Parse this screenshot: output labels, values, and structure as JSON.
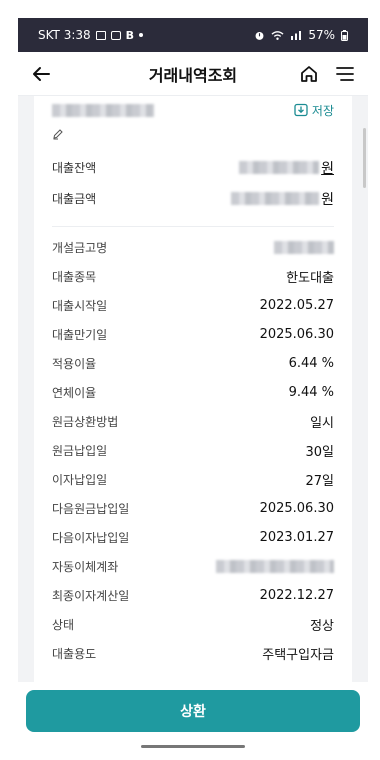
{
  "status_bar": {
    "carrier_time": "SKT 3:38",
    "battery": "57%",
    "left_icons": [
      "gallery-icon",
      "chat-icon",
      "b-app-icon",
      "dot-icon"
    ],
    "right_icons": [
      "alarm-icon",
      "wifi-icon",
      "signal-icon",
      "battery-icon"
    ]
  },
  "app_bar": {
    "title": "거래내역조회",
    "back_icon": "back-arrow-icon",
    "home_icon": "home-icon",
    "menu_icon": "menu-icon"
  },
  "card": {
    "save_label": "저장",
    "amounts": [
      {
        "label": "대출잔액",
        "unit": "원"
      },
      {
        "label": "대출금액",
        "unit": "원"
      }
    ],
    "details": [
      {
        "label": "개설금고명",
        "value": null
      },
      {
        "label": "대출종목",
        "value": "한도대출"
      },
      {
        "label": "대출시작일",
        "value": "2022.05.27"
      },
      {
        "label": "대출만기일",
        "value": "2025.06.30"
      },
      {
        "label": "적용이율",
        "value": "6.44 %"
      },
      {
        "label": "연체이율",
        "value": "9.44 %"
      },
      {
        "label": "원금상환방법",
        "value": "일시"
      },
      {
        "label": "원금납입일",
        "value": "30일"
      },
      {
        "label": "이자납입일",
        "value": "27일"
      },
      {
        "label": "다음원금납입일",
        "value": "2025.06.30"
      },
      {
        "label": "다음이자납입일",
        "value": "2023.01.27"
      },
      {
        "label": "자동이체계좌",
        "value": null
      },
      {
        "label": "최종이자계산일",
        "value": "2022.12.27"
      },
      {
        "label": "상태",
        "value": "정상"
      },
      {
        "label": "대출용도",
        "value": "주택구입자금"
      }
    ]
  },
  "bottom": {
    "repay_label": "상환"
  },
  "colors": {
    "accent": "#1f9aa0",
    "status_bar": "#2b2b3a"
  }
}
